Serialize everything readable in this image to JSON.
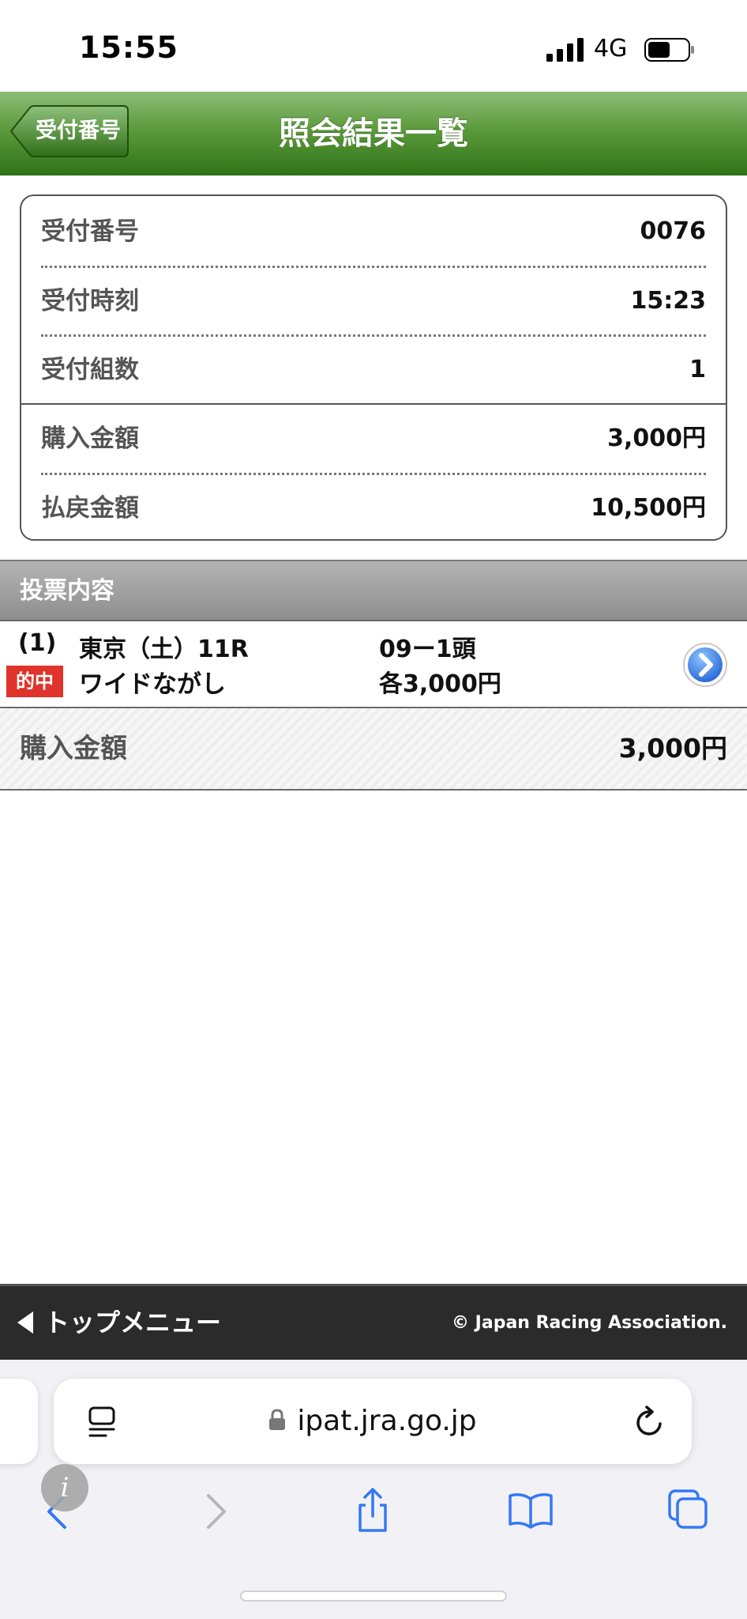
{
  "status_bar": {
    "time": "15:55",
    "network": "4G"
  },
  "header": {
    "back_label": "受付番号",
    "title": "照会結果一覧",
    "color": "#3f8225"
  },
  "summary": {
    "rows": [
      {
        "label": "受付番号",
        "value": "0076"
      },
      {
        "label": "受付時刻",
        "value": "15:23"
      },
      {
        "label": "受付組数",
        "value": "1"
      },
      {
        "label": "購入金額",
        "value": "3,000円"
      },
      {
        "label": "払戻金額",
        "value": "10,500円"
      }
    ]
  },
  "bets_section": {
    "title": "投票内容",
    "entry": {
      "number": "(1)",
      "race": "東京（土）11R",
      "horses": "09ー1頭",
      "badge": "的中",
      "badge_color": "#e0332c",
      "bet_type": "ワイドながし",
      "amount": "各3,000円"
    }
  },
  "total": {
    "label": "購入金額",
    "value": "3,000円"
  },
  "footer": {
    "menu_label": "トップメニュー",
    "copyright": "© Japan Racing Association."
  },
  "browser": {
    "url": "ipat.jra.go.jp",
    "accent": "#3478f6"
  }
}
